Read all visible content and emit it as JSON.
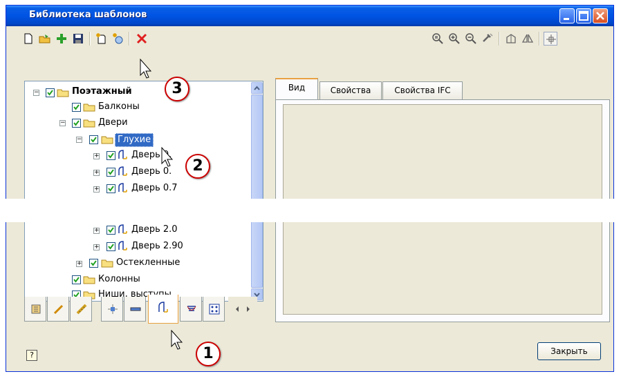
{
  "window": {
    "title": "Библиотека шаблонов",
    "minimize_icon": "minimize-icon",
    "maximize_icon": "maximize-icon",
    "close_icon": "close-icon"
  },
  "toolbar": {
    "left": [
      "new-document-icon",
      "open-folder-icon",
      "add-icon",
      "save-icon",
      "new-template-icon",
      "new-template-from-model-icon",
      "delete-icon"
    ],
    "right": [
      "zoom-window-icon",
      "zoom-in-icon",
      "zoom-out-icon",
      "pan-icon",
      "rotate-view-icon",
      "mirror-icon",
      "center-icon"
    ]
  },
  "tree": {
    "root": "Поэтажный",
    "items": [
      {
        "label": "Балконы"
      },
      {
        "label": "Двери"
      },
      {
        "label": "Глухие"
      },
      {
        "label": "Дверь 0."
      },
      {
        "label": "Дверь 0."
      },
      {
        "label": "Дверь 0.7"
      },
      {
        "label": "Дверь 2.0"
      },
      {
        "label": "Дверь 2.90"
      },
      {
        "label": "Остекленные"
      },
      {
        "label": "Колонны"
      },
      {
        "label": "Ниши, выступы"
      }
    ]
  },
  "category_tabs": [
    "apartment-icon",
    "pencil-icon",
    "ruler-icon",
    "column-icon",
    "beam-icon",
    "door-icon",
    "stairs-icon",
    "grid-icon"
  ],
  "right_panel": {
    "tabs": [
      {
        "label": "Вид"
      },
      {
        "label": "Свойства"
      },
      {
        "label": "Свойства IFC"
      }
    ]
  },
  "buttons": {
    "close": "Закрыть",
    "help": "?"
  },
  "callouts": [
    "3",
    "2",
    "1"
  ]
}
